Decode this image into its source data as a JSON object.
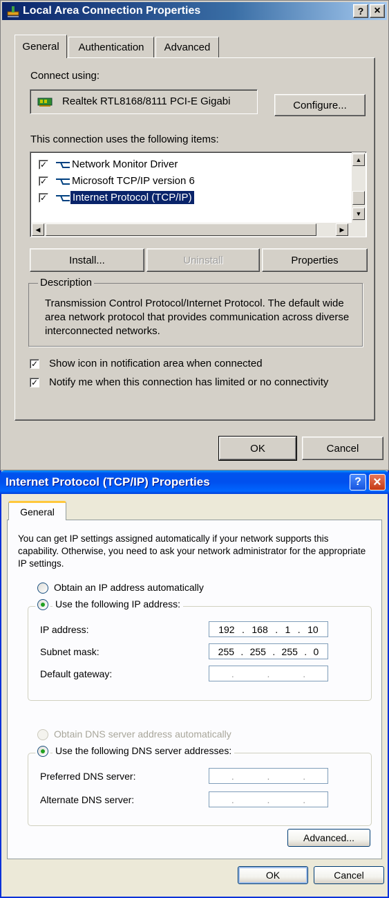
{
  "window1": {
    "title": "Local Area Connection Properties",
    "help_btn": "?",
    "close_btn": "×",
    "tabs": [
      "General",
      "Authentication",
      "Advanced"
    ],
    "connect_using_label": "Connect using:",
    "adapter_name": "Realtek RTL8168/8111 PCI-E Gigabi",
    "configure_btn": "Configure...",
    "items_label": "This connection uses the following items:",
    "items": [
      {
        "label": "Network Monitor Driver",
        "checked": true
      },
      {
        "label": "Microsoft TCP/IP version 6",
        "checked": true
      },
      {
        "label": "Internet Protocol (TCP/IP)",
        "checked": true,
        "selected": true
      }
    ],
    "install_btn": "Install...",
    "uninstall_btn": "Uninstall",
    "properties_btn": "Properties",
    "description_title": "Description",
    "description_text": "Transmission Control Protocol/Internet Protocol. The default wide area network protocol that provides communication across diverse interconnected networks.",
    "show_icon_label": "Show icon in notification area when connected",
    "notify_label": "Notify me when this connection has limited or no connectivity",
    "ok_btn": "OK",
    "cancel_btn": "Cancel"
  },
  "window2": {
    "title": "Internet Protocol (TCP/IP) Properties",
    "help_btn": "?",
    "close_btn": "×",
    "tab": "General",
    "intro": "You can get IP settings assigned automatically if your network supports this capability. Otherwise, you need to ask your network administrator for the appropriate IP settings.",
    "obtain_ip_auto": "Obtain an IP address automatically",
    "use_following_ip": "Use the following IP address:",
    "ip_label": "IP address:",
    "ip_parts": [
      "192",
      "168",
      "1",
      "10"
    ],
    "subnet_label": "Subnet mask:",
    "subnet_parts": [
      "255",
      "255",
      "255",
      "0"
    ],
    "gateway_label": "Default gateway:",
    "obtain_dns_auto": "Obtain DNS server address automatically",
    "use_following_dns": "Use the following DNS server addresses:",
    "preferred_dns_label": "Preferred DNS server:",
    "alternate_dns_label": "Alternate DNS server:",
    "advanced_btn": "Advanced...",
    "ok_btn": "OK",
    "cancel_btn": "Cancel"
  }
}
